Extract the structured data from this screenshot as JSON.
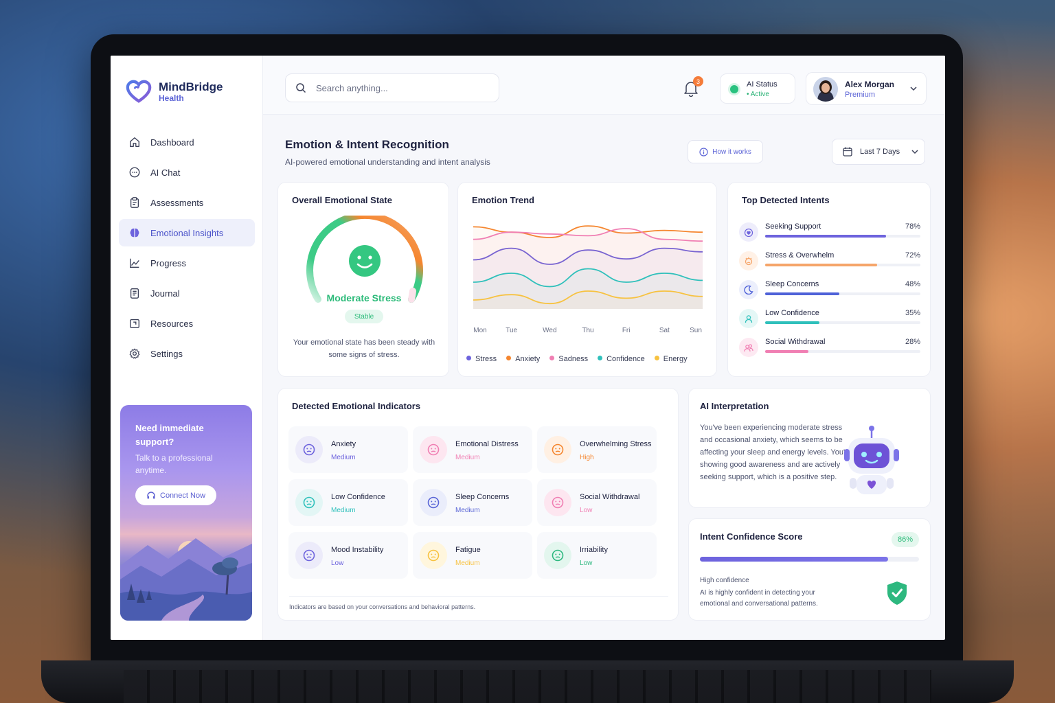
{
  "brand": {
    "name": "MindBridge",
    "sub": "Health"
  },
  "nav": [
    {
      "label": "Dashboard",
      "icon": "home-icon"
    },
    {
      "label": "AI Chat",
      "icon": "chat-icon"
    },
    {
      "label": "Assessments",
      "icon": "clipboard-icon"
    },
    {
      "label": "Emotional Insights",
      "icon": "brain-icon",
      "active": true
    },
    {
      "label": "Progress",
      "icon": "chart-icon"
    },
    {
      "label": "Journal",
      "icon": "journal-icon"
    },
    {
      "label": "Resources",
      "icon": "folder-icon"
    },
    {
      "label": "Settings",
      "icon": "gear-icon"
    }
  ],
  "help": {
    "title": "Need immediate support?",
    "text": "Talk to a professional anytime.",
    "button": "Connect Now"
  },
  "search": {
    "placeholder": "Search anything..."
  },
  "notifications": {
    "count": "3"
  },
  "ai_status": {
    "label": "AI Status",
    "value": "Active"
  },
  "user": {
    "name": "Alex Morgan",
    "tier": "Premium"
  },
  "page": {
    "title": "Emotion & Intent Recognition",
    "subtitle": "AI-powered emotional understanding and intent analysis",
    "how_label": "How it works",
    "range_label": "Last 7 Days"
  },
  "state": {
    "title": "Overall Emotional State",
    "label": "Moderate Stress",
    "badge": "Stable",
    "description": "Your emotional state has been steady with some signs of stress."
  },
  "trend": {
    "title": "Emotion Trend"
  },
  "chart_data": {
    "type": "line",
    "title": "Emotion Trend",
    "categories": [
      "Mon",
      "Tue",
      "Wed",
      "Thu",
      "Fri",
      "Sat",
      "Sun"
    ],
    "series": [
      {
        "name": "Stress",
        "color": "#6d63dd",
        "values": [
          0.55,
          0.68,
          0.5,
          0.66,
          0.56,
          0.68,
          0.64
        ]
      },
      {
        "name": "Anxiety",
        "color": "#f5862f",
        "values": [
          0.92,
          0.86,
          0.8,
          0.93,
          0.85,
          0.88,
          0.86
        ]
      },
      {
        "name": "Sadness",
        "color": "#f07fb3",
        "values": [
          0.78,
          0.86,
          0.84,
          0.82,
          0.9,
          0.78,
          0.76
        ]
      },
      {
        "name": "Confidence",
        "color": "#2fc0bb",
        "values": [
          0.3,
          0.4,
          0.25,
          0.45,
          0.3,
          0.4,
          0.32
        ]
      },
      {
        "name": "Energy",
        "color": "#f7c240",
        "values": [
          0.1,
          0.16,
          0.06,
          0.2,
          0.12,
          0.2,
          0.14
        ]
      }
    ],
    "legend": "bottom"
  },
  "intents": {
    "title": "Top Detected Intents",
    "items": [
      {
        "name": "Seeking Support",
        "pct": "78%",
        "value": 78,
        "color": "#6d63dd",
        "bg": "#eeedfb",
        "icon": "hands-heart-icon"
      },
      {
        "name": "Stress & Overwhelm",
        "pct": "72%",
        "value": 72,
        "color": "#f5a56a",
        "bg": "#fff1e6",
        "icon": "stress-face-icon"
      },
      {
        "name": "Sleep Concerns",
        "pct": "48%",
        "value": 48,
        "color": "#4f62d8",
        "bg": "#eceffc",
        "icon": "moon-icon"
      },
      {
        "name": "Low Confidence",
        "pct": "35%",
        "value": 35,
        "color": "#2fc0bb",
        "bg": "#e4f7f6",
        "icon": "person-icon"
      },
      {
        "name": "Social Withdrawal",
        "pct": "28%",
        "value": 28,
        "color": "#f07fb3",
        "bg": "#fde9f2",
        "icon": "people-icon"
      }
    ]
  },
  "indicators": {
    "title": "Detected Emotional Indicators",
    "note": "Indicators are based on your conversations and behavioral patterns.",
    "items": [
      {
        "name": "Anxiety",
        "level": "Medium",
        "color": "#6d63dd",
        "bg": "#ecebfa"
      },
      {
        "name": "Emotional Distress",
        "level": "Medium",
        "color": "#f07fb3",
        "bg": "#fde6f0"
      },
      {
        "name": "Overwhelming Stress",
        "level": "High",
        "color": "#f5862f",
        "bg": "#fff0e3"
      },
      {
        "name": "Low Confidence",
        "level": "Medium",
        "color": "#2fc0bb",
        "bg": "#e3f6f5"
      },
      {
        "name": "Sleep Concerns",
        "level": "Medium",
        "color": "#5965d6",
        "bg": "#eaedfb"
      },
      {
        "name": "Social Withdrawal",
        "level": "Low",
        "color": "#f07fb3",
        "bg": "#fde6f0"
      },
      {
        "name": "Mood Instability",
        "level": "Low",
        "color": "#6d63dd",
        "bg": "#ecebfa"
      },
      {
        "name": "Fatigue",
        "level": "Medium",
        "color": "#f7c240",
        "bg": "#fff6dd"
      },
      {
        "name": "Irriability",
        "level": "Low",
        "color": "#2db87f",
        "bg": "#e3f6ee"
      }
    ]
  },
  "interpretation": {
    "title": "AI Interpretation",
    "text": "You've been experiencing moderate stress and occasional anxiety, which seems to be affecting your sleep and energy levels. You're showing good awareness and are actively seeking support, which is a positive step."
  },
  "confidence": {
    "title": "Intent Confidence Score",
    "pct": "86%",
    "value": 86,
    "heading": "High confidence",
    "text": "AI is highly confident in detecting your emotional and conversational patterns."
  }
}
